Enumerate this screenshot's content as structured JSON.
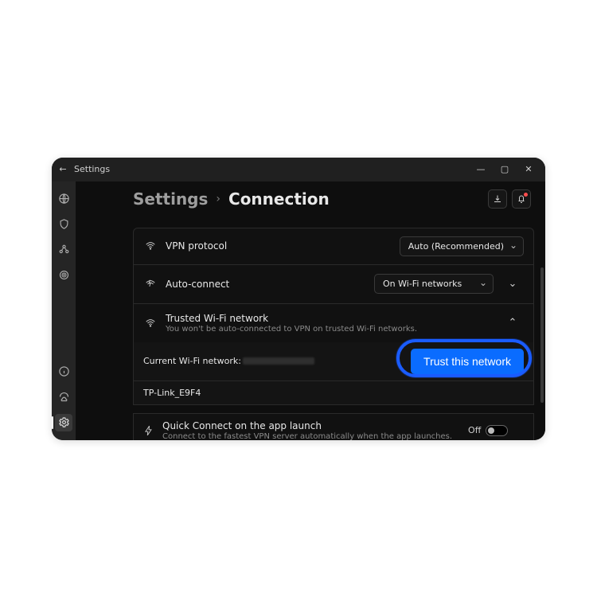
{
  "window": {
    "app_title": "Settings",
    "back_glyph": "←",
    "minimize_glyph": "—",
    "maximize_glyph": "▢",
    "close_glyph": "✕"
  },
  "sidebar": {
    "top_icons": [
      "globe-icon",
      "shield-icon",
      "pair-icon",
      "target-icon"
    ],
    "bottom_icons": [
      "info-icon",
      "security-icon",
      "gear-icon"
    ],
    "active": "gear-icon"
  },
  "header": {
    "breadcrumb_root": "Settings",
    "breadcrumb_separator": "›",
    "breadcrumb_page": "Connection",
    "download_glyph": "⬇",
    "bell_glyph": "⤴"
  },
  "rows": {
    "vpn_protocol": {
      "label": "VPN protocol",
      "select_value": "Auto (Recommended)"
    },
    "auto_connect": {
      "label": "Auto-connect",
      "select_value": "On Wi-Fi networks",
      "chevron": "⌄"
    },
    "trusted": {
      "label": "Trusted Wi-Fi network",
      "sub": "You won't be auto-connected to VPN on trusted Wi-Fi networks.",
      "chevron": "⌃"
    },
    "current_network": {
      "label": "Current Wi-Fi network:",
      "value_obscured": true,
      "trust_button": "Trust this network"
    },
    "trusted_list": [
      "TP-Link_E9F4"
    ],
    "quick_connect": {
      "label": "Quick Connect on the app launch",
      "sub": "Connect to the fastest VPN server automatically when the app launches.",
      "toggle_value": "Off"
    }
  },
  "highlight": {
    "target": "trust-network-button"
  }
}
